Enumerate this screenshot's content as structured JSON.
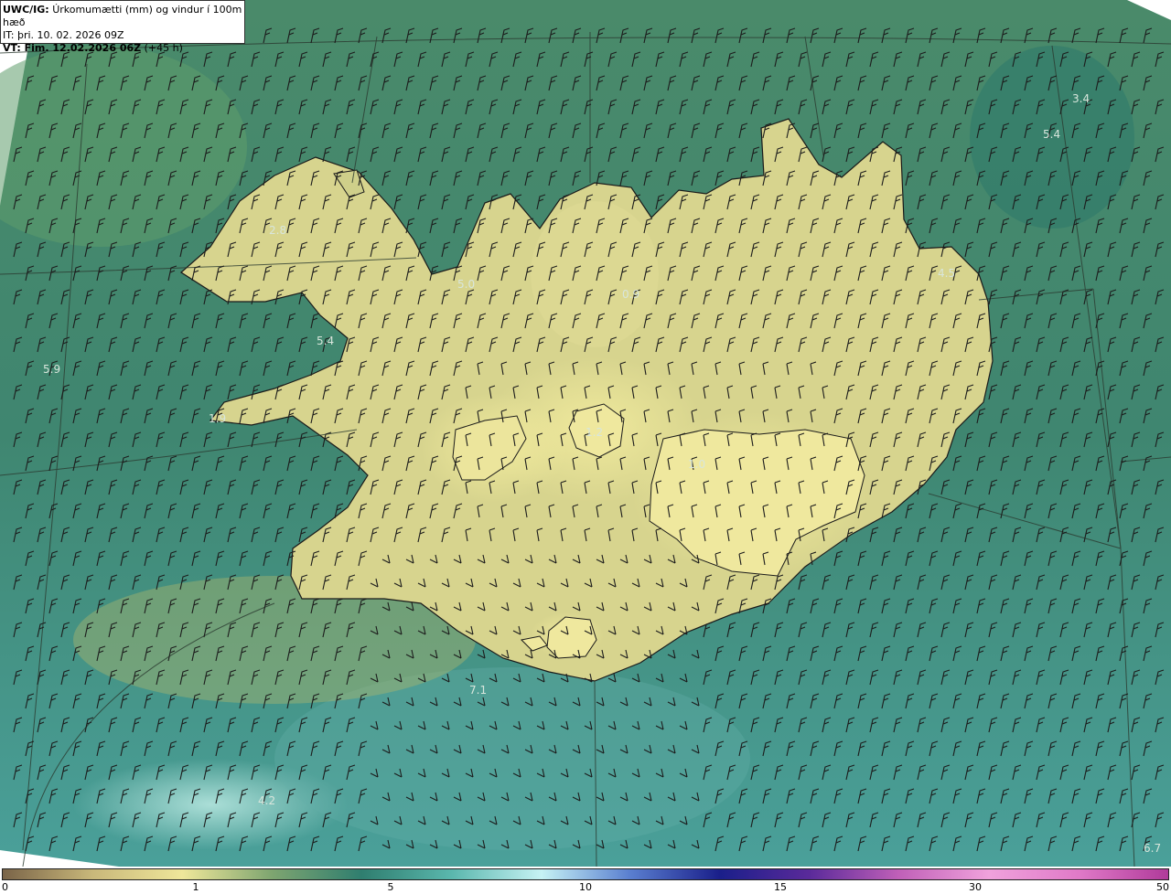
{
  "header": {
    "product": "UWC/IG:",
    "description": "Úrkomumætti (mm) og vindur í 100m hæð",
    "issue_time": "IT: þri. 10. 02. 2026 09Z",
    "valid_prefix": "VT: Fim. 12.02.2026 06Z",
    "valid_suffix": "(+45 h)"
  },
  "colorbar": {
    "ticks": [
      "0",
      "1",
      "5",
      "10",
      "15",
      "30",
      "50"
    ],
    "colors": [
      "#7a6448",
      "#c9b87a",
      "#efe79a",
      "#7ea570",
      "#2f7e6f",
      "#5ab7ad",
      "#c6f2f4",
      "#5a7fd0",
      "#1a1f8a",
      "#5a2a9a",
      "#c060b8",
      "#f0a2dc",
      "#e07ac8",
      "#b03a9a"
    ]
  },
  "map": {
    "labels": [
      {
        "text": "3.4"
      },
      {
        "text": "5.4"
      },
      {
        "text": "2.8"
      },
      {
        "text": "5.0"
      },
      {
        "text": "4.5"
      },
      {
        "text": "5.4"
      },
      {
        "text": "5.9"
      },
      {
        "text": "1.9"
      },
      {
        "text": "0.9"
      },
      {
        "text": "1.0"
      },
      {
        "text": "1.2"
      },
      {
        "text": "7.1"
      },
      {
        "text": "6.7"
      },
      {
        "text": "4.2"
      }
    ],
    "land_color": "#e8e39a",
    "sea_color": "#3f8a72"
  }
}
